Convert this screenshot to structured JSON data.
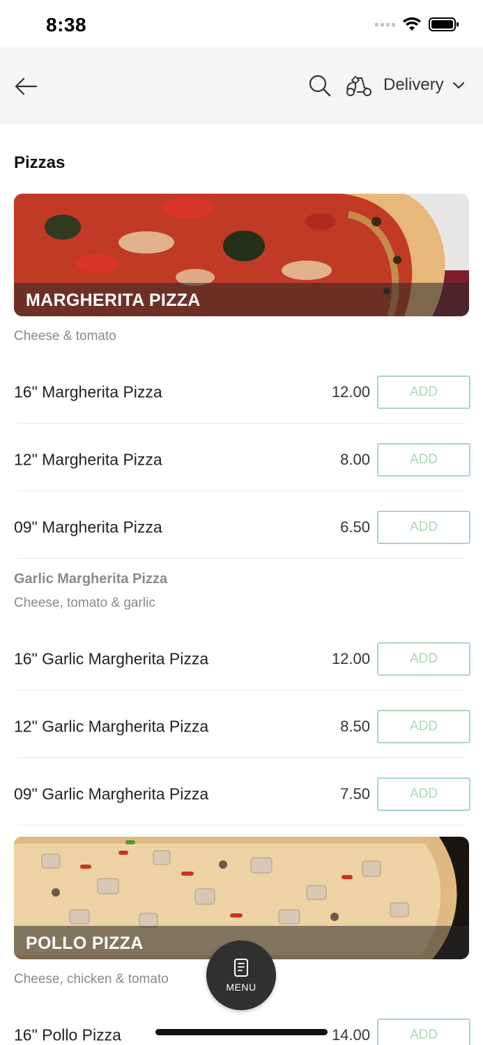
{
  "status_bar": {
    "time": "8:38"
  },
  "header": {
    "delivery_label": "Delivery"
  },
  "section_title": "Pizzas",
  "groups": [
    {
      "banner_title": "MARGHERITA PIZZA",
      "description": "Cheese & tomato",
      "items": [
        {
          "name": "16\" Margherita Pizza",
          "price": "12.00",
          "add_label": "ADD"
        },
        {
          "name": "12\" Margherita Pizza",
          "price": "8.00",
          "add_label": "ADD"
        },
        {
          "name": "09\" Margherita Pizza",
          "price": "6.50",
          "add_label": "ADD"
        }
      ]
    },
    {
      "subheading": "Garlic Margherita Pizza",
      "description": "Cheese, tomato & garlic",
      "items": [
        {
          "name": "16\" Garlic Margherita Pizza",
          "price": "12.00",
          "add_label": "ADD"
        },
        {
          "name": "12\" Garlic Margherita Pizza",
          "price": "8.50",
          "add_label": "ADD"
        },
        {
          "name": "09\" Garlic Margherita Pizza",
          "price": "7.50",
          "add_label": "ADD"
        }
      ]
    },
    {
      "banner_title": "POLLO PIZZA",
      "description": "Cheese, chicken & tomato",
      "items": [
        {
          "name": "16\" Pollo Pizza",
          "price": "14.00",
          "add_label": "ADD"
        }
      ]
    }
  ],
  "menu_button": {
    "label": "MENU"
  },
  "colors": {
    "add_border": "#a9d8b8",
    "header_bg": "#f5f5f5",
    "fab_bg": "#2f3032"
  }
}
